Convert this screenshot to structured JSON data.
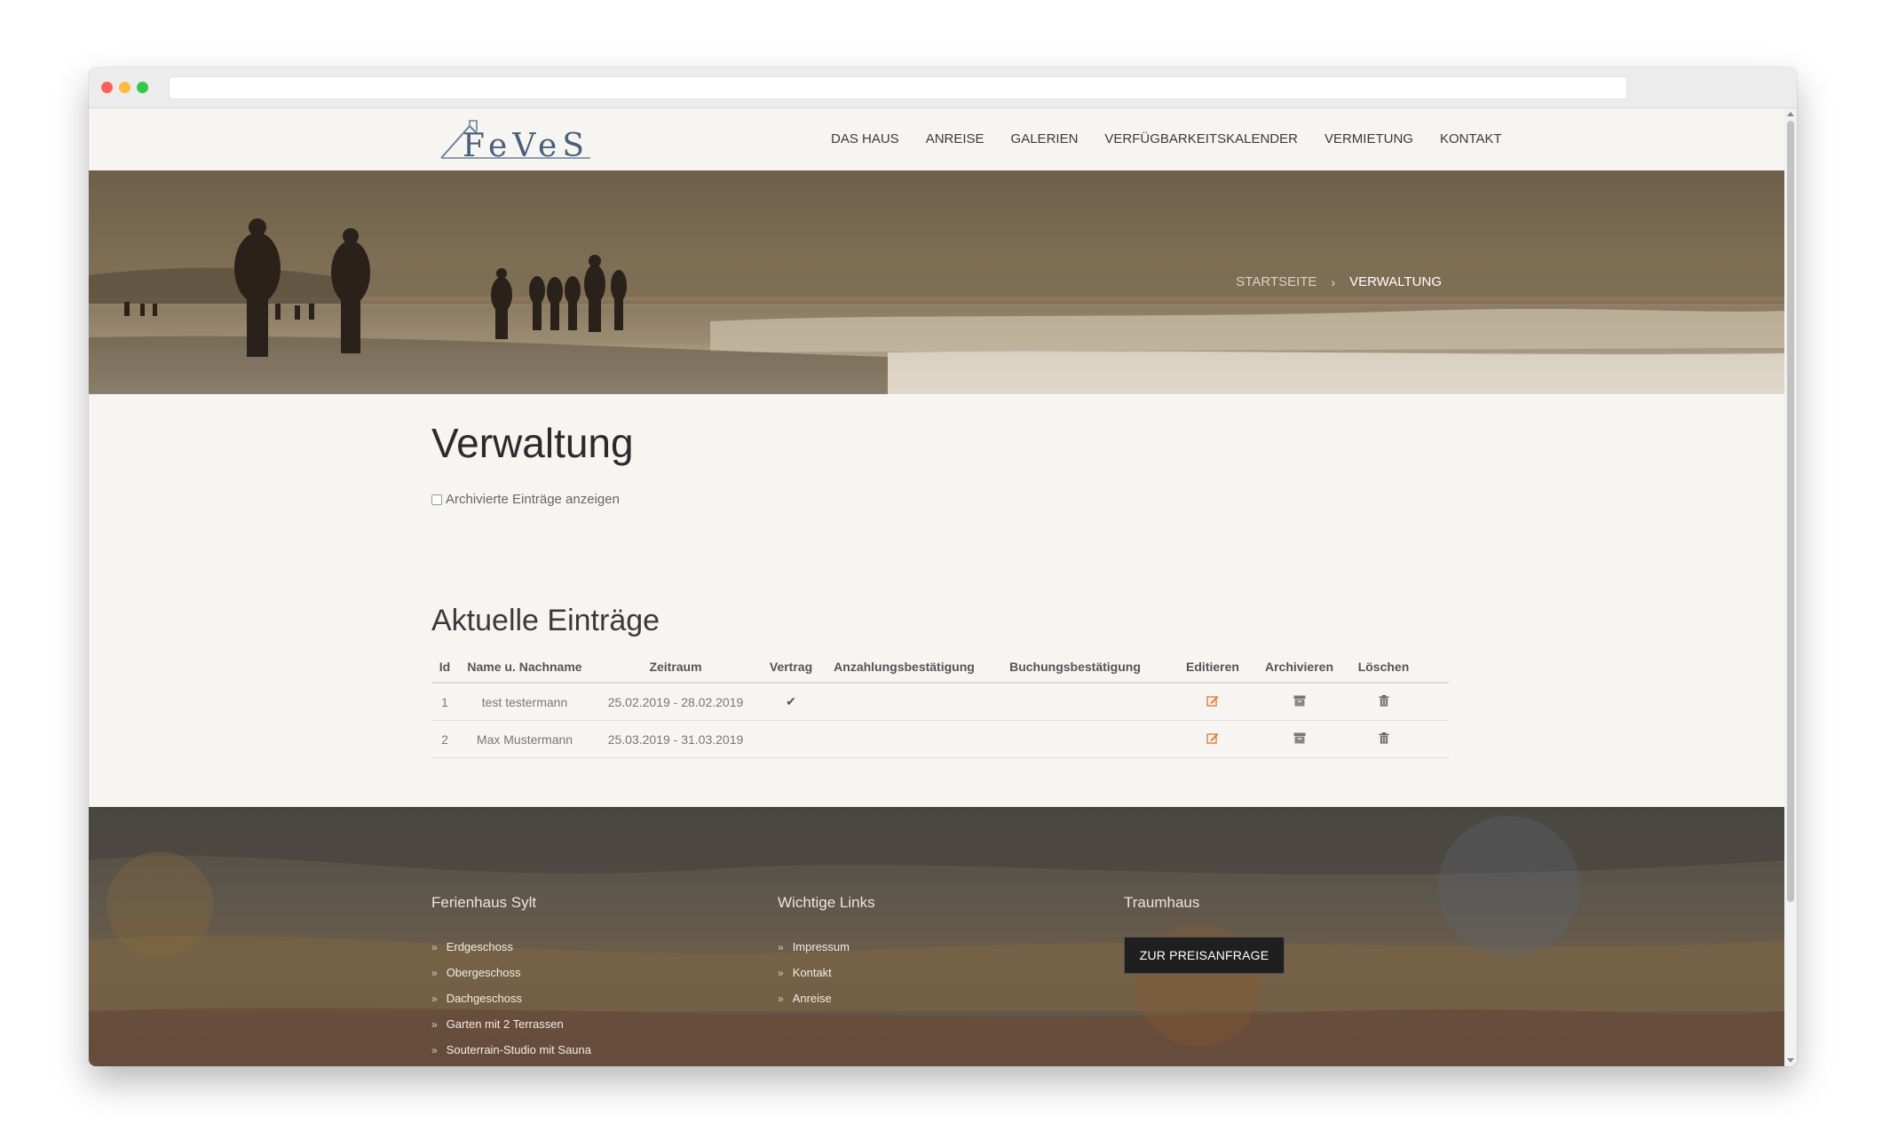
{
  "logo": {
    "text": "FeVeS"
  },
  "nav": [
    "DAS HAUS",
    "ANREISE",
    "GALERIEN",
    "VERFÜGBARKEITSKALENDER",
    "VERMIETUNG",
    "KONTAKT"
  ],
  "breadcrumb": {
    "home": "STARTSEITE",
    "separator": "›",
    "current": "VERWALTUNG"
  },
  "page": {
    "title": "Verwaltung",
    "archived_label": "Archivierte Einträge anzeigen",
    "archived_checked": false,
    "section_title": "Aktuelle Einträge"
  },
  "table": {
    "headers": {
      "id": "Id",
      "name": "Name u. Nachname",
      "zeitraum": "Zeitraum",
      "vertrag": "Vertrag",
      "anzahlung": "Anzahlungsbestätigung",
      "buchung": "Buchungsbestätigung",
      "editieren": "Editieren",
      "archivieren": "Archivieren",
      "loeschen": "Löschen"
    },
    "rows": [
      {
        "id": "1",
        "name": "test testermann",
        "zeitraum": "25.02.2019 - 28.02.2019",
        "vertrag": "✔",
        "anzahlung": "",
        "buchung": ""
      },
      {
        "id": "2",
        "name": "Max Mustermann",
        "zeitraum": "25.03.2019 - 31.03.2019",
        "vertrag": "",
        "anzahlung": "",
        "buchung": ""
      }
    ],
    "icons": {
      "edit": "edit-icon",
      "archive": "archive-icon",
      "delete": "trash-icon"
    }
  },
  "footer": {
    "col1": {
      "title": "Ferienhaus Sylt",
      "links": [
        "Erdgeschoss",
        "Obergeschoss",
        "Dachgeschoss",
        "Garten mit 2 Terrassen",
        "Souterrain-Studio mit Sauna"
      ]
    },
    "col2": {
      "title": "Wichtige Links",
      "links": [
        "Impressum",
        "Kontakt",
        "Anreise"
      ]
    },
    "col3": {
      "title": "Traumhaus",
      "button": "ZUR PREISANFRAGE"
    }
  },
  "colors": {
    "accent_edit": "#e0803a",
    "page_bg": "#f6f5f2",
    "text_dark": "#2b2b2b"
  }
}
